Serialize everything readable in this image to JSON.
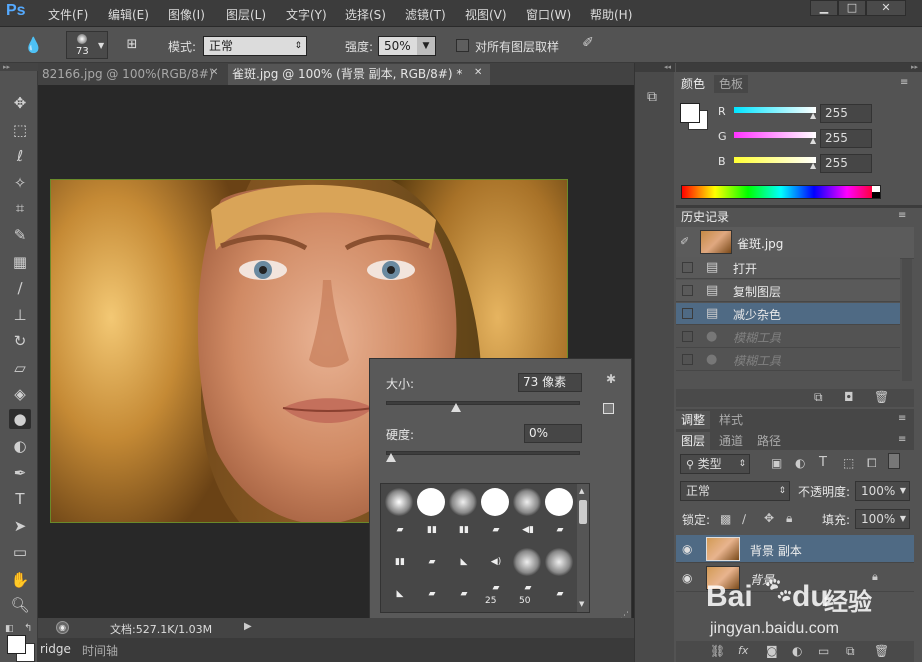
{
  "app": {
    "logo": "Ps"
  },
  "menu": [
    "文件(F)",
    "编辑(E)",
    "图像(I)",
    "图层(L)",
    "文字(Y)",
    "选择(S)",
    "滤镜(T)",
    "视图(V)",
    "窗口(W)",
    "帮助(H)"
  ],
  "window_buttons": [
    "▁",
    "□",
    "✕"
  ],
  "options": {
    "brush_size": "73",
    "mode_label": "模式:",
    "mode_value": "正常",
    "strength_label": "强度:",
    "strength_value": "50%",
    "sample_all_label": "对所有图层取样"
  },
  "tabs": [
    {
      "label": "82166.jpg @ 100%(RGB/8#)",
      "close": "✕",
      "active": false
    },
    {
      "label": "雀斑.jpg @ 100% (背景 副本, RGB/8#) *",
      "close": "✕",
      "active": true
    }
  ],
  "status": {
    "doc": "文档:527.1K/1.03M"
  },
  "bottom_tabs": [
    "ridge",
    "时间轴"
  ],
  "color_panel": {
    "tabs": [
      "颜色",
      "色板"
    ],
    "channels": [
      {
        "name": "R",
        "value": "255",
        "color": "#00e5ff"
      },
      {
        "name": "G",
        "value": "255",
        "color": "#ff33ff"
      },
      {
        "name": "B",
        "value": "255",
        "color": "#ffff33"
      }
    ]
  },
  "history_panel": {
    "title": "历史记录",
    "snapshot": "雀斑.jpg",
    "items": [
      {
        "label": "打开",
        "disabled": false,
        "selected": false
      },
      {
        "label": "复制图层",
        "disabled": false,
        "selected": false
      },
      {
        "label": "减少杂色",
        "disabled": false,
        "selected": true
      },
      {
        "label": "模糊工具",
        "disabled": true,
        "selected": false
      },
      {
        "label": "模糊工具",
        "disabled": true,
        "selected": false
      }
    ]
  },
  "adjust_tabs": [
    "调整",
    "样式"
  ],
  "layers_panel": {
    "tabs": [
      "图层",
      "通道",
      "路径"
    ],
    "filter_type": "类型",
    "blend_mode": "正常",
    "opacity_label": "不透明度:",
    "opacity_value": "100%",
    "lock_label": "锁定:",
    "fill_label": "填充:",
    "fill_value": "100%",
    "layers": [
      {
        "name": "背景 副本",
        "selected": true
      },
      {
        "name": "背景",
        "selected": false
      }
    ]
  },
  "brush_popup": {
    "size_label": "大小:",
    "size_value": "73 像素",
    "size_fraction": 0.36,
    "hardness_label": "硬度:",
    "hardness_value": "0%",
    "hardness_fraction": 0.0,
    "numbers": [
      "25",
      "50"
    ]
  },
  "watermark": {
    "brand": "Bai",
    "brand2": "du",
    "cn": "经验",
    "url": "jingyan.baidu.com"
  }
}
